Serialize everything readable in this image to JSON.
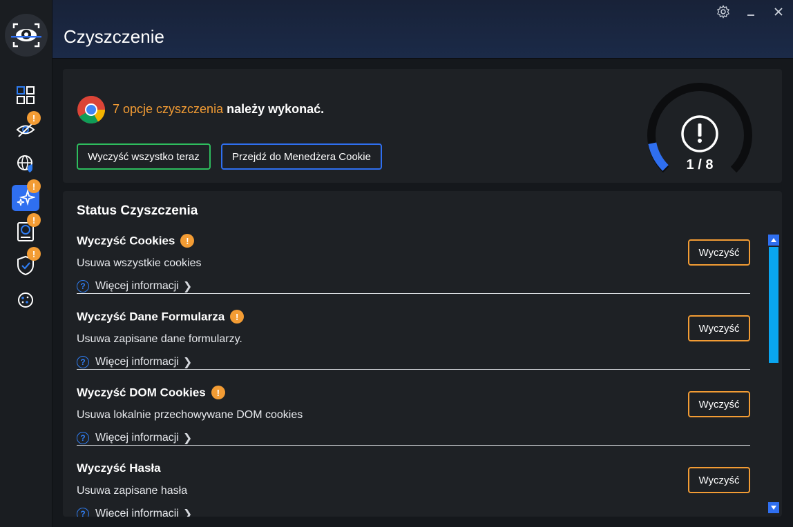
{
  "header": {
    "title": "Czyszczenie"
  },
  "sidebar": {
    "items": [
      {
        "name": "dashboard",
        "badge": ""
      },
      {
        "name": "privacy",
        "badge": "!"
      },
      {
        "name": "web",
        "badge": ""
      },
      {
        "name": "cleaning",
        "badge": "!",
        "active": true
      },
      {
        "name": "disk",
        "badge": "!"
      },
      {
        "name": "protection",
        "badge": "!"
      },
      {
        "name": "cookies",
        "badge": ""
      }
    ]
  },
  "summary": {
    "count_text": "7 opcje czyszczenia",
    "rest_text": " należy wykonać.",
    "clean_all_label": "Wyczyść wszystko teraz",
    "cookie_manager_label": "Przejdź do Menedżera Cookie",
    "gauge_label": "1 / 8",
    "progress": 0.125
  },
  "status": {
    "title": "Status Czyszczenia",
    "more_label": "Więcej informacji",
    "clean_label": "Wyczyść",
    "items": [
      {
        "title": "Wyczyść Cookies",
        "desc": "Usuwa wszystkie cookies",
        "warning": "!"
      },
      {
        "title": "Wyczyść Dane Formularza",
        "desc": "Usuwa zapisane dane formularzy.",
        "warning": "!"
      },
      {
        "title": "Wyczyść DOM Cookies",
        "desc": "Usuwa lokalnie przechowywane DOM cookies",
        "warning": "!"
      },
      {
        "title": "Wyczyść Hasła",
        "desc": "Usuwa zapisane hasła",
        "warning": ""
      }
    ]
  },
  "colors": {
    "accent_orange": "#f39c34",
    "accent_blue": "#2f6ff0",
    "accent_green": "#2ebd5e"
  }
}
